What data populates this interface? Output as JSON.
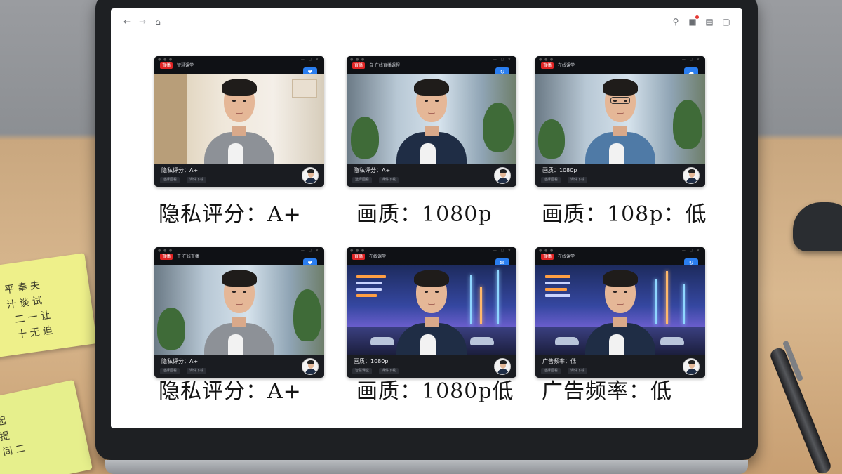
{
  "desk": {
    "sticky_note_top_lines": "平 奉 夫\n汁 谈 试\n  二 一 让\n  十 无 迫",
    "sticky_note_bottom_lines": "起\n提\n间 二"
  },
  "toolbar": {
    "back_icon": "←",
    "forward_icon": "→",
    "home_icon": "⌂",
    "search_icon": "⚲",
    "extensions_icon": "▣",
    "document_icon": "▤",
    "window_icon": "▢"
  },
  "cards": [
    {
      "logo": "直播",
      "title": "智慧课堂",
      "caption": "隐私评分：A+",
      "chips": [
        "选择回看",
        "课件下载"
      ],
      "badge": "❤",
      "label": "隐私评分：A+"
    },
    {
      "logo": "直播",
      "title": "自 在线直播课程",
      "caption": "隐私评分：A+",
      "chips": [
        "选择回看",
        "课件下载"
      ],
      "badge": "↻",
      "label": "画质：1080p"
    },
    {
      "logo": "直播",
      "title": "在线课堂",
      "caption": "画质：1080p",
      "chips": [
        "选择回看",
        "课件下载"
      ],
      "badge": "☁",
      "label": "画质：108p：低"
    },
    {
      "logo": "直播",
      "title": "平 在线直播",
      "caption": "隐私评分：A+",
      "chips": [
        "选择回看",
        "课件下载"
      ],
      "badge": "❤",
      "label": "隐私评分：A+"
    },
    {
      "logo": "直播",
      "title": "在线课堂",
      "caption": "画质：1080p",
      "chips": [
        "智慧课堂",
        "课件下载"
      ],
      "badge": "✉",
      "label": "画质：1080p低"
    },
    {
      "logo": "直播",
      "title": "在线课堂",
      "caption": "广告频率：低",
      "chips": [
        "选择回看",
        "课件下载"
      ],
      "badge": "↻",
      "label": "广告频率：低"
    }
  ],
  "colors": {
    "accent_red": "#e02424",
    "badge_blue": "#2a7ef0",
    "screen_white": "#ffffff",
    "bezel": "#1e2023"
  }
}
